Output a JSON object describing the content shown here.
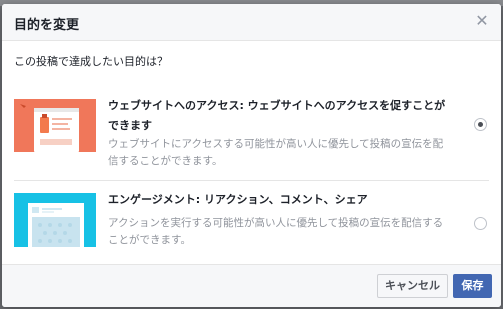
{
  "dialog": {
    "title": "目的を変更",
    "close_icon": "close-icon",
    "question": "この投稿で達成したい目的は？"
  },
  "objectives": [
    {
      "title": "ウェブサイトへのアクセス: ウェブサイトへのアクセスを促すことができます",
      "description": "ウェブサイトにアクセスする可能性が高い人に優先して投稿の宣伝を配信することができます。",
      "selected": true,
      "thumbnail_color": "#f0775a"
    },
    {
      "title": "エンゲージメント: リアクション、コメント、シェア",
      "description": "アクションを実行する可能性が高い人に優先して投稿の宣伝を配信することができます。",
      "selected": false,
      "thumbnail_color": "#17c1e5"
    }
  ],
  "footer": {
    "cancel_label": "キャンセル",
    "save_label": "保存"
  },
  "colors": {
    "accent": "#4267b2",
    "header_bg": "#f6f7f9"
  }
}
